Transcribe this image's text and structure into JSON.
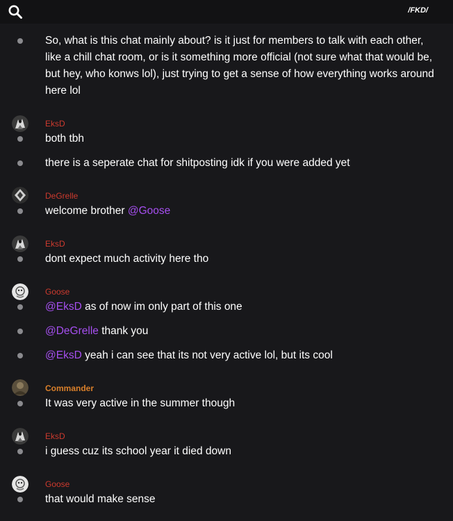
{
  "header": {
    "channel_tag": "/FKD/",
    "search_icon": "search-icon"
  },
  "colors": {
    "background": "#18181b",
    "topbar": "#121214",
    "author_red": "#cc3a2e",
    "author_orange": "#d97f2a",
    "mention": "#a64ff0",
    "bullet": "#8a8a8e"
  },
  "messages": [
    {
      "text": "So, what is this chat mainly about? is it just for members to talk with each other, like a chill chat room, or is it something more official (not sure what that would be, but hey, who konws lol), just trying to get a sense of how everything works around here lol"
    },
    {
      "author": "EksD",
      "text": "both tbh"
    },
    {
      "text": "there is a seperate chat for shitposting idk if you were added yet"
    },
    {
      "author": "DeGrelle",
      "text": "welcome brother ",
      "mention_after": "@Goose"
    },
    {
      "author": "EksD",
      "text": "dont expect much activity here tho"
    },
    {
      "author": "Goose",
      "mention": "@EksD",
      "text": " as of now im only part of this one"
    },
    {
      "mention": "@DeGrelle",
      "text": " thank you"
    },
    {
      "mention": "@EksD",
      "text": " yeah i can see that its not very active lol, but its cool"
    },
    {
      "author": "Commander",
      "text": "It was very active in the summer though"
    },
    {
      "author": "EksD",
      "text": "i guess cuz its school year it died down"
    },
    {
      "author": "Goose",
      "text": "that would make sense"
    }
  ]
}
